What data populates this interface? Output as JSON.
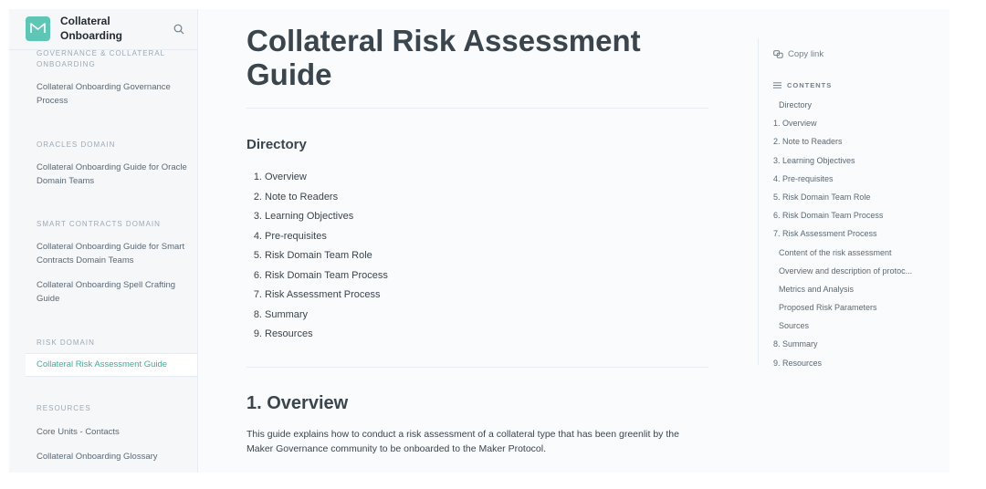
{
  "sidebar": {
    "space_title": "Collateral Onboarding",
    "sections": [
      {
        "title": "Governance & Collateral Onboarding",
        "items": [
          {
            "label": "Collateral Onboarding Governance Process"
          }
        ]
      },
      {
        "title": "Oracles Domain",
        "items": [
          {
            "label": "Collateral Onboarding Guide for Oracle Domain Teams"
          }
        ]
      },
      {
        "title": "Smart Contracts Domain",
        "items": [
          {
            "label": "Collateral Onboarding Guide for Smart Contracts Domain Teams"
          },
          {
            "label": "Collateral Onboarding Spell Crafting Guide"
          }
        ]
      },
      {
        "title": "Risk Domain",
        "items": [
          {
            "label": "Collateral Risk Assessment Guide",
            "active": true
          }
        ]
      },
      {
        "title": "Resources",
        "items": [
          {
            "label": "Core Units - Contacts"
          },
          {
            "label": "Collateral Onboarding Glossary"
          }
        ]
      }
    ]
  },
  "main": {
    "title": "Collateral Risk Assessment Guide",
    "directory_heading": "Directory",
    "directory": [
      {
        "num": "1.",
        "label": "Overview"
      },
      {
        "num": "2.",
        "label": "Note to Readers"
      },
      {
        "num": "3.",
        "label": "Learning Objectives"
      },
      {
        "num": "4.",
        "label": "Pre-requisites"
      },
      {
        "num": "5.",
        "label": "Risk Domain Team Role"
      },
      {
        "num": "6.",
        "label": "Risk Domain Team Process"
      },
      {
        "num": "7.",
        "label": "Risk Assessment Process"
      },
      {
        "num": "8.",
        "label": "Summary"
      },
      {
        "num": "9.",
        "label": "Resources"
      }
    ],
    "overview_heading": "1. Overview",
    "overview_text": "This guide explains how to conduct a risk assessment of a collateral type that has been greenlit by the Maker Governance community to be onboarded to the Maker Protocol."
  },
  "rail": {
    "copy_link": "Copy link",
    "contents_label": "CONTENTS",
    "toc": [
      {
        "label": "Directory",
        "level": 2
      },
      {
        "label": "1. Overview",
        "level": 1
      },
      {
        "label": "2. Note to Readers",
        "level": 1
      },
      {
        "label": "3. Learning Objectives",
        "level": 1
      },
      {
        "label": "4. Pre-requisites",
        "level": 1
      },
      {
        "label": "5. Risk Domain Team Role",
        "level": 1
      },
      {
        "label": "6. Risk Domain Team Process",
        "level": 1
      },
      {
        "label": "7. Risk Assessment Process",
        "level": 1
      },
      {
        "label": "Content of the risk assessment",
        "level": 2
      },
      {
        "label": "Overview and description of protoc...",
        "level": 2
      },
      {
        "label": "Metrics and Analysis",
        "level": 2
      },
      {
        "label": "Proposed Risk Parameters",
        "level": 2
      },
      {
        "label": "Sources",
        "level": 2
      },
      {
        "label": "8. Summary",
        "level": 1
      },
      {
        "label": "9. Resources",
        "level": 1
      }
    ]
  },
  "icons": {
    "logo": "logo-icon",
    "search": "search-icon",
    "copy": "link-icon",
    "contents": "list-icon"
  },
  "colors": {
    "accent": "#34b39b",
    "logo_bg": "#5ec6b4",
    "sidebar_bg": "#f5f7f9",
    "text": "#3b454e"
  }
}
